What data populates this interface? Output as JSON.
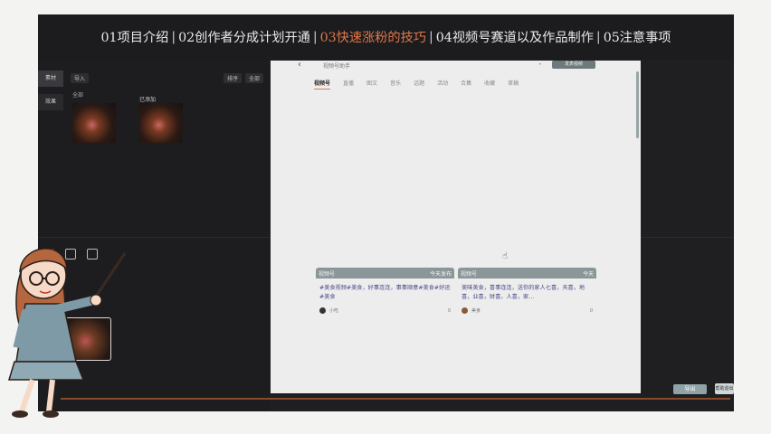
{
  "lesson_bar": {
    "items": [
      {
        "label": "01项目介绍",
        "active": false
      },
      {
        "label": "02创作者分成计划开通",
        "active": false
      },
      {
        "label": "03快速涨粉的技巧",
        "active": true
      },
      {
        "label": "04视频号赛道以及作品制作",
        "active": false
      },
      {
        "label": "05注意事项",
        "active": false
      }
    ],
    "active_color": "#e0774a"
  },
  "editor": {
    "side_tabs": [
      "素材",
      "效果"
    ],
    "pane_head": {
      "folder": "导入",
      "view": "排序",
      "filter": "全部"
    },
    "folder_label": "全部",
    "thumbnails": [
      {
        "label": ""
      },
      {
        "label": "已添加"
      }
    ],
    "export_label": "导出",
    "export2_label": "帮助退出"
  },
  "browser": {
    "title": "视频号助手",
    "button": "发表视频",
    "tabs": [
      {
        "label": "视频号",
        "active": true
      },
      {
        "label": "直播",
        "active": false
      },
      {
        "label": "图文",
        "active": false
      },
      {
        "label": "音乐",
        "active": false
      },
      {
        "label": "话题",
        "active": false
      },
      {
        "label": "活动",
        "active": false
      },
      {
        "label": "合集",
        "active": false
      },
      {
        "label": "收藏",
        "active": false
      },
      {
        "label": "草稿",
        "active": false
      }
    ],
    "cards": [
      {
        "head_left": "视频号",
        "head_right": "今天发布",
        "desc": "#美食视频#美食，好事连连，事事顺意#美食#好运#美食",
        "user": "小吃",
        "likes": "0"
      },
      {
        "head_left": "视频号",
        "head_right": "今天",
        "desc": "美味美食，喜事连连，送你的家人七喜，天喜，地喜，业喜，财喜，人喜，家…",
        "user": "美食",
        "likes": "0"
      }
    ]
  },
  "colors": {
    "accent": "#e0774a",
    "frame": "#1c1c1e",
    "page_bg": "#f3f3f1",
    "card_head": "#8a9698"
  }
}
